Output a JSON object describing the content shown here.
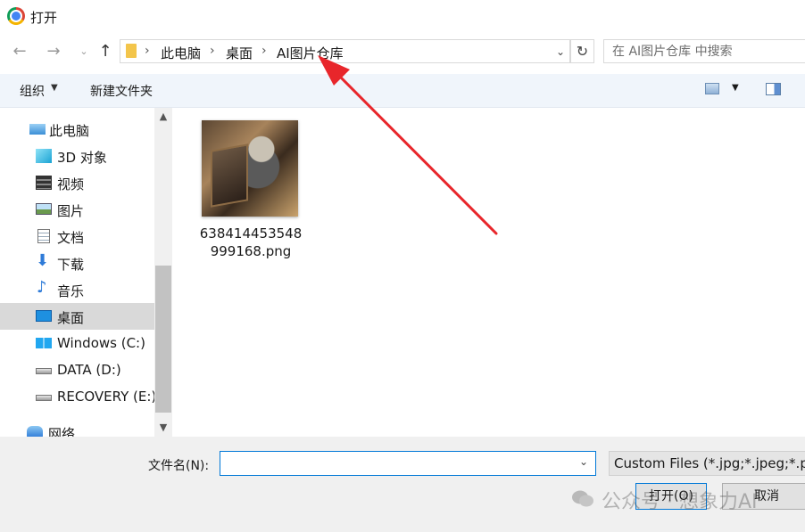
{
  "window": {
    "title": "打开"
  },
  "address": {
    "crumbs": [
      "此电脑",
      "桌面",
      "AI图片仓库"
    ],
    "separator": "›"
  },
  "search": {
    "placeholder": "在 AI图片仓库 中搜索"
  },
  "toolbar": {
    "organize_label": "组织",
    "new_folder_label": "新建文件夹"
  },
  "nav_pane": {
    "items": [
      {
        "label": "此电脑",
        "icon": "computer-icon"
      },
      {
        "label": "3D 对象",
        "icon": "3d-objects-icon"
      },
      {
        "label": "视频",
        "icon": "video-icon"
      },
      {
        "label": "图片",
        "icon": "pictures-icon"
      },
      {
        "label": "文档",
        "icon": "documents-icon"
      },
      {
        "label": "下载",
        "icon": "download-icon"
      },
      {
        "label": "音乐",
        "icon": "music-icon"
      },
      {
        "label": "桌面",
        "icon": "desktop-icon",
        "selected": true
      },
      {
        "label": "Windows (C:)",
        "icon": "windows-drive-icon"
      },
      {
        "label": "DATA (D:)",
        "icon": "drive-icon"
      },
      {
        "label": "RECOVERY (E:)",
        "icon": "drive-icon"
      },
      {
        "label": "网络",
        "icon": "network-icon"
      }
    ]
  },
  "files": [
    {
      "name": "638414453548999168.png"
    }
  ],
  "bottom": {
    "filename_label": "文件名(N):",
    "filename_value": "",
    "filetype_value": "Custom Files (*.jpg;*.jpeg;*.p",
    "open_label": "打开(O)",
    "cancel_label": "取消"
  },
  "watermark": {
    "text": "公众号 · 想象力AI"
  },
  "colors": {
    "annotation_arrow": "#e8262b",
    "accent": "#0078d7",
    "selection": "#d9d9d9"
  }
}
